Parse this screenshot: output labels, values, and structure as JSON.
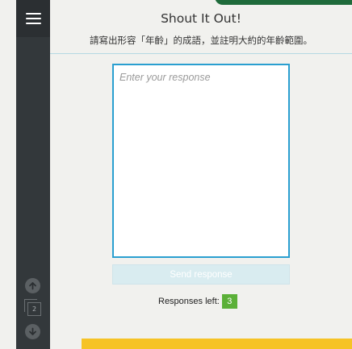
{
  "header": {
    "title": "Shout It Out!",
    "prompt": "請寫出形容「年齡」的成語，並註明大約的年齡範圍。"
  },
  "response": {
    "placeholder": "Enter your response",
    "value": ""
  },
  "send_button": {
    "label": "Send response",
    "enabled": false
  },
  "responses_left": {
    "label": "Responses left:",
    "count": "3"
  },
  "sidebar": {
    "menu_icon": "hamburger-menu-icon",
    "nav_up_icon": "arrow-up-circle-icon",
    "nav_down_icon": "arrow-down-circle-icon",
    "slide_counter": "2"
  },
  "colors": {
    "sidebar": "#2b2f32",
    "accent_border": "#2a9fd0",
    "badge_green": "#5bb038",
    "footer_yellow": "#f6c325",
    "top_tab_green": "#1f6b3b"
  }
}
